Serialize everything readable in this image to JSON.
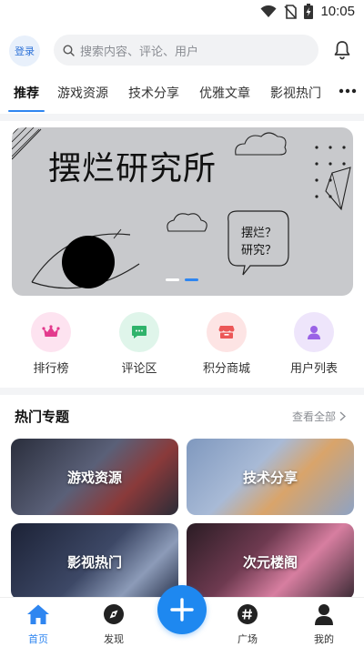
{
  "status_bar": {
    "time": "10:05"
  },
  "header": {
    "login_label": "登录",
    "search_placeholder": "搜索内容、评论、用户"
  },
  "tabs": [
    {
      "label": "推荐",
      "active": true
    },
    {
      "label": "游戏资源"
    },
    {
      "label": "技术分享"
    },
    {
      "label": "优雅文章"
    },
    {
      "label": "影视热门"
    }
  ],
  "banner": {
    "title": "摆烂研究所",
    "bubble_line1": "摆烂？",
    "bubble_line2": "研究？",
    "slides": 2,
    "active_slide": 2
  },
  "quick_links": [
    {
      "label": "排行榜",
      "icon": "crown-icon",
      "bg": "#fde3f0",
      "color": "#e33a8d"
    },
    {
      "label": "评论区",
      "icon": "chat-icon",
      "bg": "#dff5ea",
      "color": "#2fb36b"
    },
    {
      "label": "积分商城",
      "icon": "store-icon",
      "bg": "#fde4e4",
      "color": "#ec5757"
    },
    {
      "label": "用户列表",
      "icon": "user-icon",
      "bg": "#eee5fb",
      "color": "#9a63e6"
    }
  ],
  "hot_topics": {
    "title": "热门专题",
    "view_all": "查看全部",
    "cards": [
      {
        "label": "游戏资源",
        "color": "#4a4f63"
      },
      {
        "label": "技术分享",
        "color": "#8fa6c8"
      },
      {
        "label": "影视热门",
        "color": "#2d3650"
      },
      {
        "label": "次元楼阁",
        "color": "#3b2733"
      }
    ]
  },
  "bottom_nav": {
    "items": [
      {
        "label": "首页",
        "icon": "home-icon",
        "active": true
      },
      {
        "label": "发现",
        "icon": "compass-icon"
      },
      {
        "label": "广场",
        "icon": "hashtag-icon"
      },
      {
        "label": "我的",
        "icon": "person-icon"
      }
    ],
    "fab_icon": "plus-icon"
  },
  "colors": {
    "accent": "#2f86f0",
    "fab": "#1e88f0"
  }
}
